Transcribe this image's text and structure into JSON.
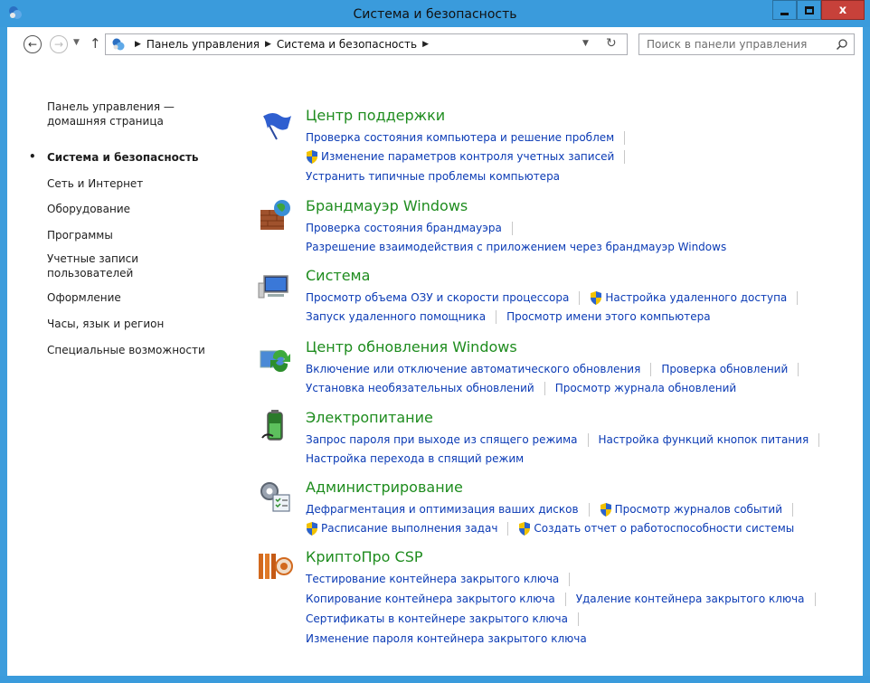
{
  "window": {
    "title": "Система и безопасность",
    "close_label": "x"
  },
  "nav": {
    "breadcrumbs": [
      "Панель управления",
      "Система и безопасность"
    ],
    "search_placeholder": "Поиск в панели управления"
  },
  "sidebar": {
    "home_line1": "Панель управления —",
    "home_line2": "домашняя страница",
    "items": [
      {
        "label": "Система и безопасность",
        "current": true
      },
      {
        "label": "Сеть и Интернет"
      },
      {
        "label": "Оборудование"
      },
      {
        "label": "Программы"
      },
      {
        "label": "Учетные записи"
      },
      {
        "label": "пользователей"
      },
      {
        "label": "Оформление"
      },
      {
        "label": "Часы, язык и регион"
      },
      {
        "label": "Специальные возможности"
      }
    ]
  },
  "sections": [
    {
      "title": "Центр поддержки",
      "icon": "flag-icon",
      "rows": [
        [
          "Проверка состояния компьютера и решение проблем"
        ],
        [
          "Изменение параметров контроля учетных записей"
        ],
        [
          "Устранить типичные проблемы компьютера"
        ]
      ]
    },
    {
      "title": "Брандмауэр Windows",
      "icon": "firewall-icon",
      "rows": [
        [
          "Проверка состояния брандмауэра"
        ],
        [
          "Разрешение взаимодействия с приложением через брандмауэр Windows"
        ]
      ]
    },
    {
      "title": "Система",
      "icon": "computer-icon",
      "rows": [
        [
          "Просмотр объема ОЗУ и скорости процессора",
          "Настройка удаленного доступа"
        ],
        [
          "Запуск удаленного помощника",
          "Просмотр имени этого компьютера"
        ]
      ]
    },
    {
      "title": "Центр обновления Windows",
      "icon": "windows-update-icon",
      "rows": [
        [
          "Включение или отключение автоматического обновления",
          "Проверка обновлений"
        ],
        [
          "Установка необязательных обновлений",
          "Просмотр журнала обновлений"
        ]
      ]
    },
    {
      "title": "Электропитание",
      "icon": "battery-icon",
      "rows": [
        [
          "Запрос пароля при выходе из спящего режима",
          "Настройка функций кнопок питания"
        ],
        [
          "Настройка перехода в спящий режим"
        ]
      ]
    },
    {
      "title": "Администрирование",
      "icon": "admin-tools-icon",
      "rows": [
        [
          "Дефрагментация и оптимизация ваших дисков",
          "Просмотр журналов событий"
        ],
        [
          "Расписание выполнения задач",
          "Создать отчет о работоспособности системы"
        ]
      ]
    },
    {
      "title": "КриптоПро CSP",
      "icon": "cryptopro-icon",
      "rows": [
        [
          "Тестирование контейнера закрытого ключа"
        ],
        [
          "Копирование контейнера закрытого ключа",
          "Удаление контейнера закрытого ключа"
        ],
        [
          "Сертификаты в контейнере закрытого ключа"
        ],
        [
          "Изменение пароля контейнера закрытого ключа"
        ]
      ]
    }
  ],
  "colors": {
    "title_bar": "#3a9bdc",
    "close_button": "#c7413a",
    "section_title": "#1e8c1e",
    "link": "#0b3bb5"
  }
}
